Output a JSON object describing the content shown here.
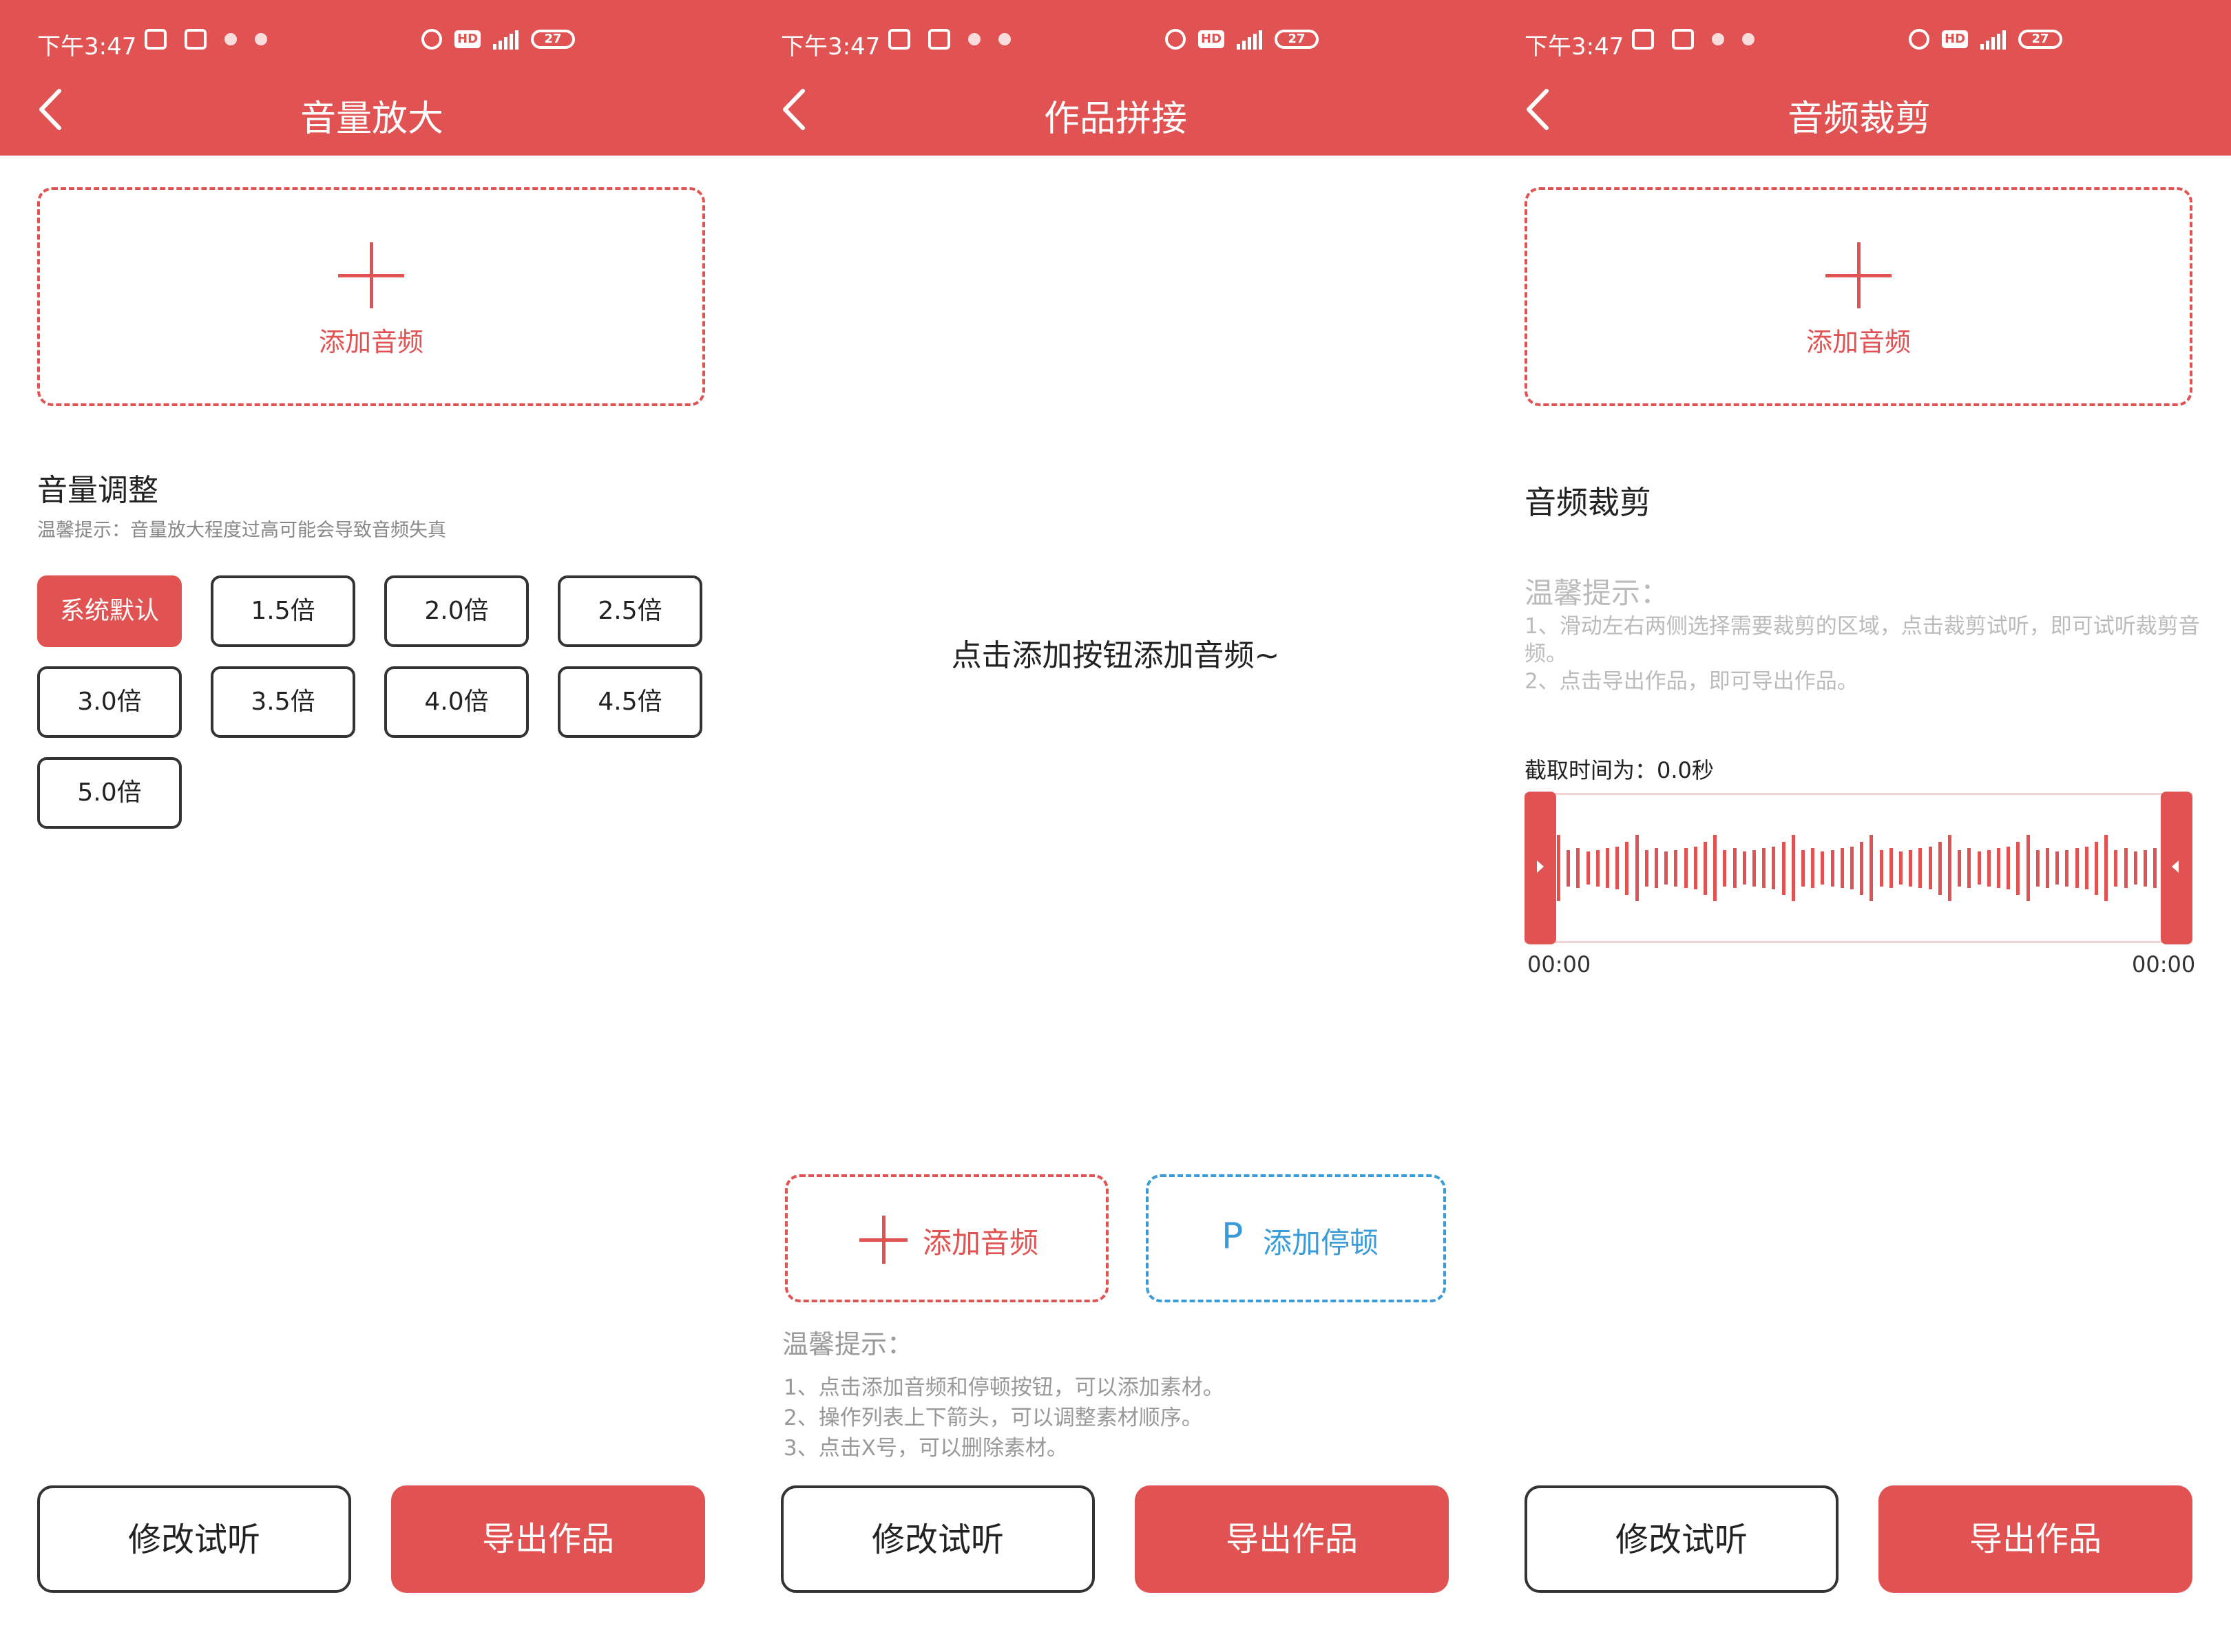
{
  "status": {
    "time": "下午3:47",
    "net": "4G",
    "battery": "27"
  },
  "colors": {
    "accent": "#E05352",
    "pause_blue": "#3A9BD9"
  },
  "screen1": {
    "title": "音量放大",
    "add_label": "添加音频",
    "section_title": "音量调整",
    "hint": "温馨提示：音量放大程度过高可能会导致音频失真",
    "options": [
      "系统默认",
      "1.5倍",
      "2.0倍",
      "2.5倍",
      "3.0倍",
      "3.5倍",
      "4.0倍",
      "4.5倍",
      "5.0倍"
    ],
    "selected": "系统默认",
    "btn_preview": "修改试听",
    "btn_export": "导出作品"
  },
  "screen2": {
    "title": "作品拼接",
    "empty_text": "点击添加按钮添加音频~",
    "add_audio": "添加音频",
    "pause_glyph": "P",
    "add_pause": "添加停顿",
    "tips_title": "温馨提示：",
    "tips": [
      "1、点击添加音频和停顿按钮，可以添加素材。",
      "2、操作列表上下箭头，可以调整素材顺序。",
      "3、点击X号，可以删除素材。"
    ],
    "btn_preview": "修改试听",
    "btn_export": "导出作品"
  },
  "screen3": {
    "title": "音频裁剪",
    "add_label": "添加音频",
    "section_title": "音频裁剪",
    "tips_title": "温馨提示：",
    "tip1": "1、滑动左右两侧选择需要裁剪的区域，点击裁剪试听，即可试听裁剪音频。",
    "tip2": "2、点击导出作品，即可导出作品。",
    "cut_time": "截取时间为：0.0秒",
    "time_start": "00:00",
    "time_end": "00:00",
    "btn_preview": "修改试听",
    "btn_export": "导出作品"
  }
}
